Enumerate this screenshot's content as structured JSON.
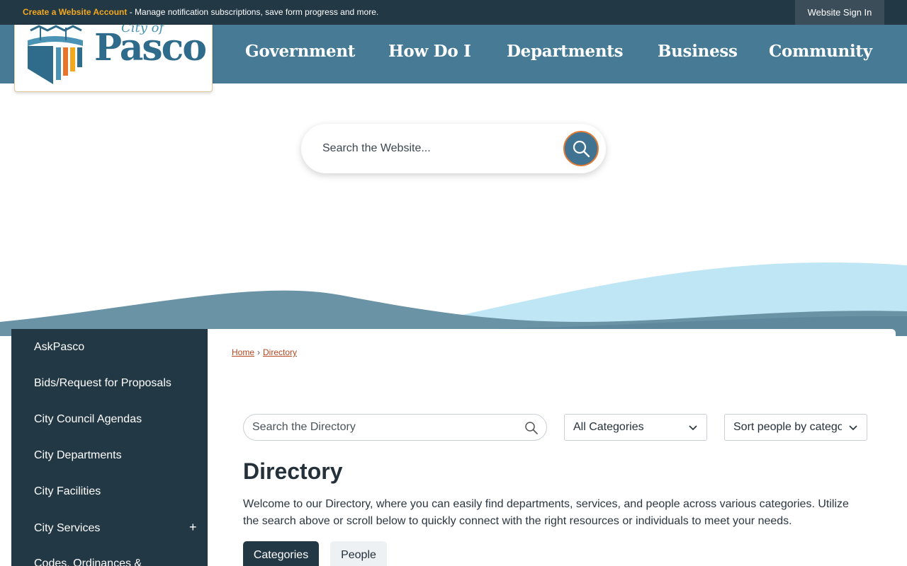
{
  "topbar": {
    "create_account": "Create a Website Account",
    "message": " - Manage notification subscriptions, save form progress and more.",
    "sign_in": "Website Sign In"
  },
  "logo": {
    "city": "City of",
    "name": "Pasco"
  },
  "nav": {
    "items": [
      "Government",
      "How Do I",
      "Departments",
      "Business",
      "Community"
    ]
  },
  "site_search": {
    "placeholder": "Search the Website..."
  },
  "sidebar": {
    "items": [
      {
        "label": "AskPasco"
      },
      {
        "label": "Bids/Request for Proposals"
      },
      {
        "label": "City Council Agendas"
      },
      {
        "label": "City Departments"
      },
      {
        "label": "City Facilities"
      },
      {
        "label": "City Services",
        "expand": "+"
      },
      {
        "label": "Codes, Ordinances &"
      }
    ]
  },
  "breadcrumb": {
    "home": "Home",
    "separator": "›",
    "current": "Directory"
  },
  "directory": {
    "search_placeholder": "Search the Directory",
    "category_select": "All Categories",
    "sort_select": "Sort people by category",
    "title": "Directory",
    "intro": "Welcome to our Directory, where you can easily find departments, services, and people across various categories. Utilize the search above or scroll below to quickly connect with the right resources or individuals to meet your needs.",
    "tabs": [
      "Categories",
      "People"
    ]
  },
  "colors": {
    "topbar": "#233845",
    "nav": "#477b95",
    "accent_orange": "#f4a81d",
    "link": "#b3461f",
    "sidebar": "#233845"
  }
}
